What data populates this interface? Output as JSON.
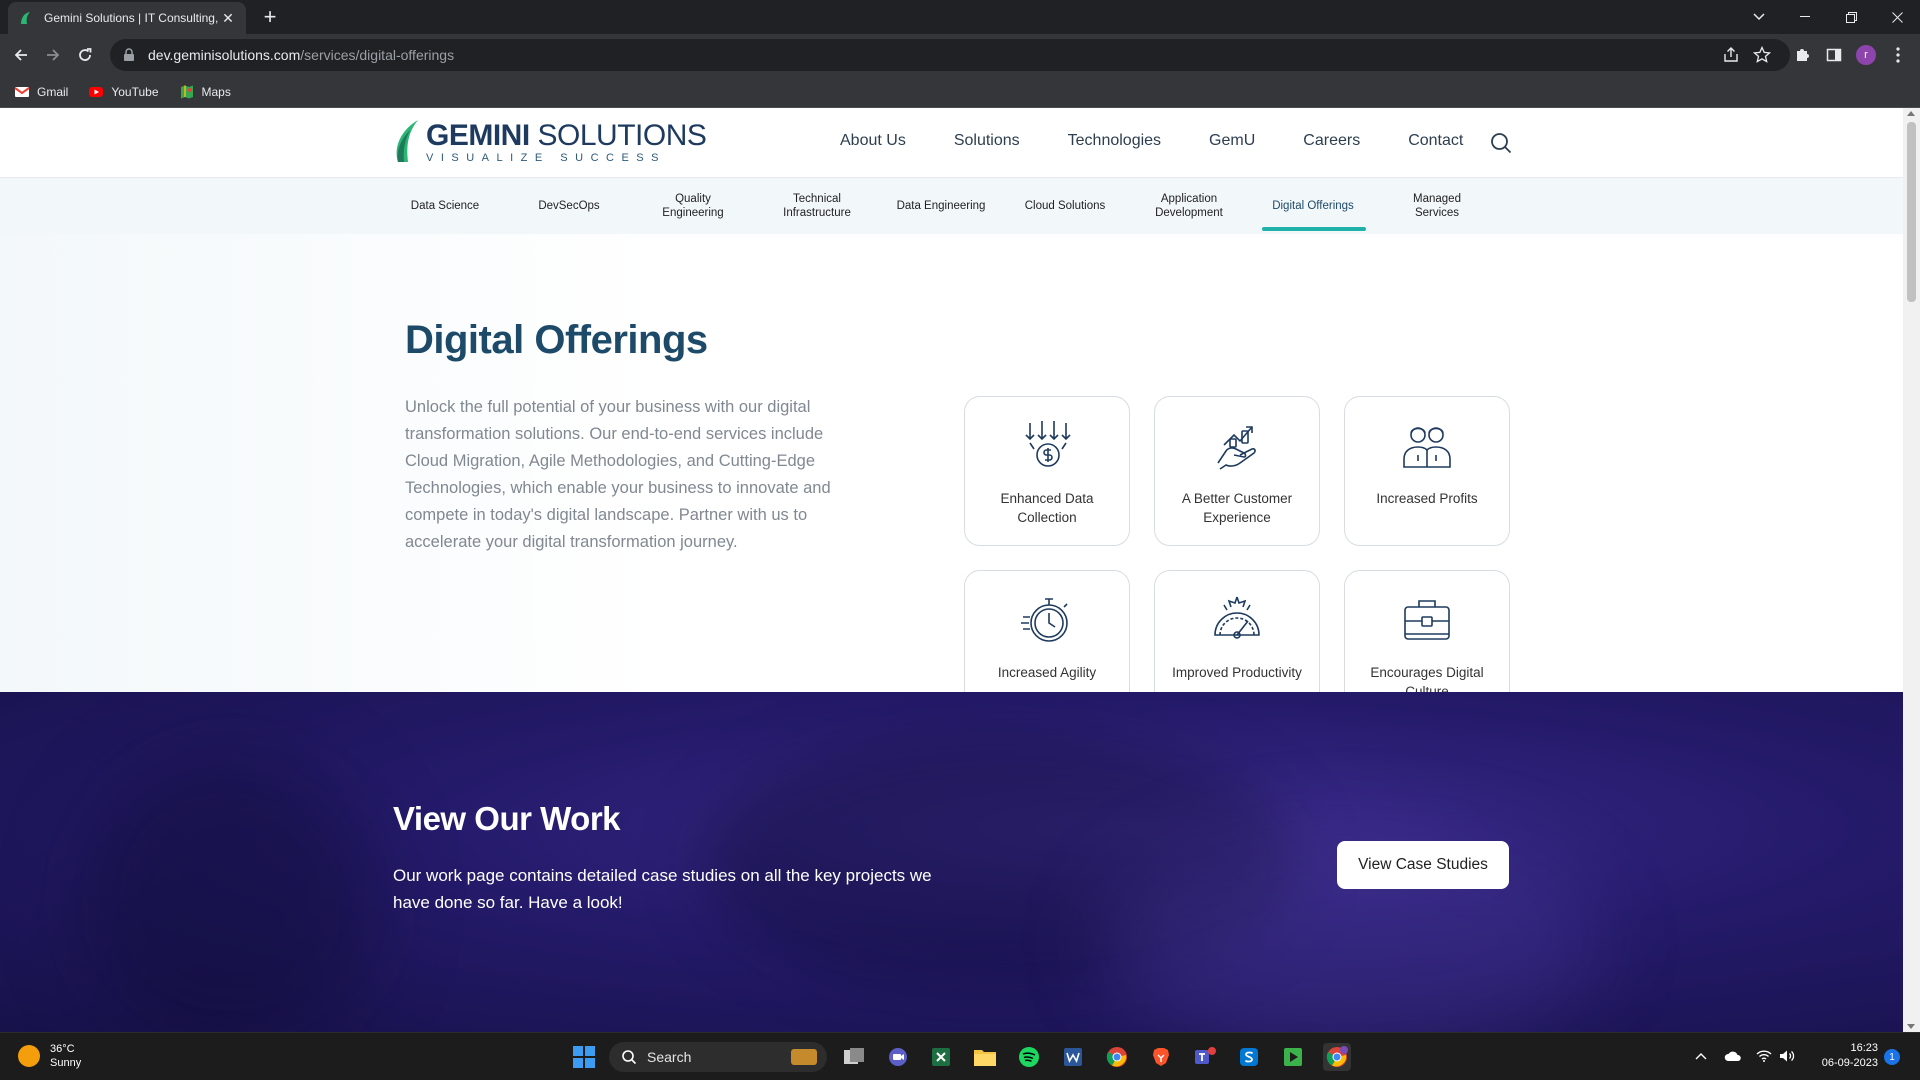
{
  "browser": {
    "tab_title": "Gemini Solutions | IT Consulting,",
    "url_host": "dev.geminisolutions.com",
    "url_path": "/services/digital-offerings",
    "profile_initial": "r",
    "bookmarks": [
      {
        "label": "Gmail",
        "icon": "gmail-icon"
      },
      {
        "label": "YouTube",
        "icon": "youtube-icon"
      },
      {
        "label": "Maps",
        "icon": "maps-icon"
      }
    ]
  },
  "site": {
    "logo": {
      "name_bold": "GEMINI",
      "name_rest": " SOLUTIONS",
      "tagline": "VISUALIZE SUCCESS"
    },
    "nav": [
      "About Us",
      "Solutions",
      "Technologies",
      "GemU",
      "Careers",
      "Contact"
    ],
    "subnav": [
      "Data Science",
      "DevSecOps",
      "Quality Engineering",
      "Technical Infrastructure",
      "Data Engineering",
      "Cloud Solutions",
      "Application Development",
      "Digital Offerings",
      "Managed Services"
    ],
    "subnav_active": "Digital Offerings",
    "accent_color": "#20b2aa",
    "brand_color": "#1e4a6a"
  },
  "hero": {
    "title": "Digital Offerings",
    "text": "Unlock the full potential of your business with our digital transformation solutions. Our end-to-end services include Cloud Migration, Agile Methodologies, and Cutting-Edge Technologies, which enable your business to innovate and compete in today's digital landscape. Partner with us to accelerate your digital transformation journey."
  },
  "cards": [
    {
      "label": "Enhanced Data Collection",
      "icon": "data-collection-icon"
    },
    {
      "label": "A Better Customer Experience",
      "icon": "customer-experience-icon"
    },
    {
      "label": "Increased Profits",
      "icon": "profits-icon"
    },
    {
      "label": "Increased Agility",
      "icon": "stopwatch-icon"
    },
    {
      "label": "Improved Productivity",
      "icon": "speedometer-icon"
    },
    {
      "label": "Encourages Digital Culture",
      "icon": "briefcase-icon"
    }
  ],
  "work": {
    "title": "View Our Work",
    "text": "Our work page contains detailed case studies on all the key projects we have done so far. Have a look!",
    "button": "View Case Studies"
  },
  "taskbar": {
    "weather_temp": "36°C",
    "weather_desc": "Sunny",
    "search_label": "Search",
    "time": "16:23",
    "date": "06-09-2023",
    "notification_count": "1"
  }
}
